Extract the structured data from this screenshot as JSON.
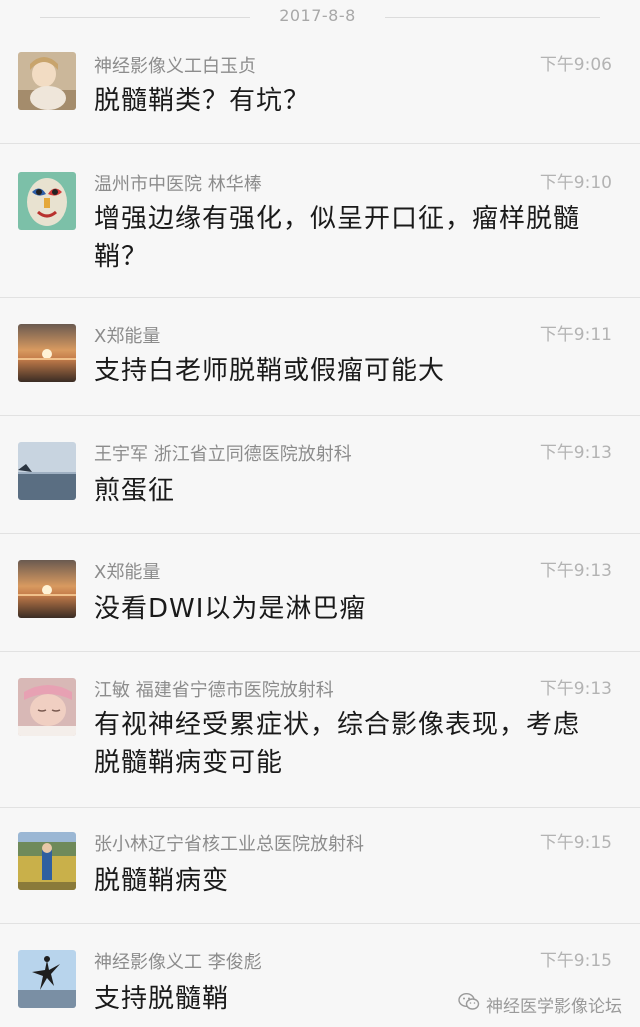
{
  "date": "2017-8-8",
  "messages": [
    {
      "sender": "神经影像义工白玉贞",
      "time": "下午9:06",
      "text": "脱髓鞘类？有坑？",
      "avatar": "child-photo"
    },
    {
      "sender": "温州市中医院 林华棒",
      "time": "下午9:10",
      "text": "增强边缘有强化，似呈开口征，瘤样脱髓鞘？",
      "avatar": "painted-mask"
    },
    {
      "sender": "X郑能量",
      "time": "下午9:11",
      "text": "支持白老师脱鞘或假瘤可能大",
      "avatar": "sunset-sea"
    },
    {
      "sender": "王宇军 浙江省立同德医院放射科",
      "time": "下午9:13",
      "text": "煎蛋征",
      "avatar": "sea-coast"
    },
    {
      "sender": "X郑能量",
      "time": "下午9:13",
      "text": "没看DWI以为是淋巴瘤",
      "avatar": "sunset-sea"
    },
    {
      "sender": "江敏 福建省宁德市医院放射科",
      "time": "下午9:13",
      "text": "有视神经受累症状，综合影像表现，考虑脱髓鞘病变可能",
      "avatar": "sleeping-baby"
    },
    {
      "sender": "张小林辽宁省核工业总医院放射科",
      "time": "下午9:15",
      "text": "脱髓鞘病变",
      "avatar": "child-outdoor"
    },
    {
      "sender": "神经影像义工 李俊彪",
      "time": "下午9:15",
      "text": "支持脱髓鞘",
      "avatar": "silhouette-jump"
    }
  ],
  "watermark": {
    "text": "神经医学影像论坛",
    "icon": "wechat-icon"
  }
}
